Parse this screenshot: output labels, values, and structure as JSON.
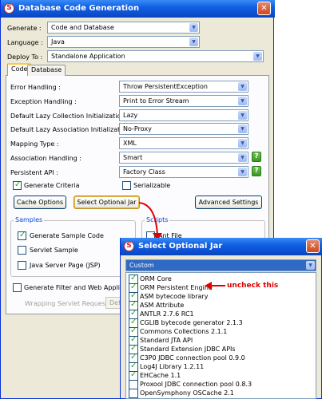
{
  "window": {
    "title": "Database Code Generation"
  },
  "top_fields": [
    {
      "label": "Generate :",
      "value": "Code and Database"
    },
    {
      "label": "Language :",
      "value": "Java"
    },
    {
      "label": "Deploy To :",
      "value": "Standalone Application"
    }
  ],
  "tabs": [
    {
      "label": "Code"
    },
    {
      "label": "Database"
    }
  ],
  "code_options": [
    {
      "label": "Error Handling :",
      "value": "Throw PersistentException"
    },
    {
      "label": "Exception Handling :",
      "value": "Print to Error Stream"
    },
    {
      "label": "Default Lazy Collection Initialization :",
      "value": "Lazy"
    },
    {
      "label": "Default Lazy Association Initialization :",
      "value": "No-Proxy"
    },
    {
      "label": "Mapping Type :",
      "value": "XML"
    },
    {
      "label": "Association Handling :",
      "value": "Smart"
    },
    {
      "label": "Persistent API :",
      "value": "Factory Class"
    }
  ],
  "checkboxes": {
    "generate_criteria": "Generate Criteria",
    "serializable": "Serializable"
  },
  "buttons": {
    "cache_options": "Cache Options",
    "select_optional_jar": "Select Optional Jar",
    "advanced_settings": "Advanced Settings"
  },
  "samples": {
    "title": "Samples",
    "items": [
      "Generate Sample Code",
      "Servlet Sample",
      "Java Server Page (JSP)"
    ]
  },
  "scripts": {
    "title": "Scripts",
    "items": [
      "Ant File"
    ]
  },
  "generate_filter": "Generate Filter and Web Application",
  "wrapping": {
    "label": "Wrapping Servlet Request :",
    "value": "Defa"
  },
  "popup": {
    "title": "Select Optional Jar",
    "filter_value": "Custom",
    "items": [
      "ORM Core",
      "ORM Persistent Engine",
      "ASM bytecode library",
      "ASM Attribute",
      "ANTLR 2.7.6 RC1",
      "CGLIB bytecode generator 2.1.3",
      "Commons Collections 2.1.1",
      "Standard JTA API",
      "Standard Extension JDBC APIs",
      "C3P0 JDBC connection pool 0.9.0",
      "Log4J Library 1.2.11",
      "EHCache 1.1",
      "Proxool JDBC connection pool 0.8.3",
      "OpenSymphony OSCache 2.1"
    ]
  },
  "annotation": "uncheck this",
  "colors": {
    "annotation": "#e00000",
    "titlebar": "#0a4ac9"
  }
}
